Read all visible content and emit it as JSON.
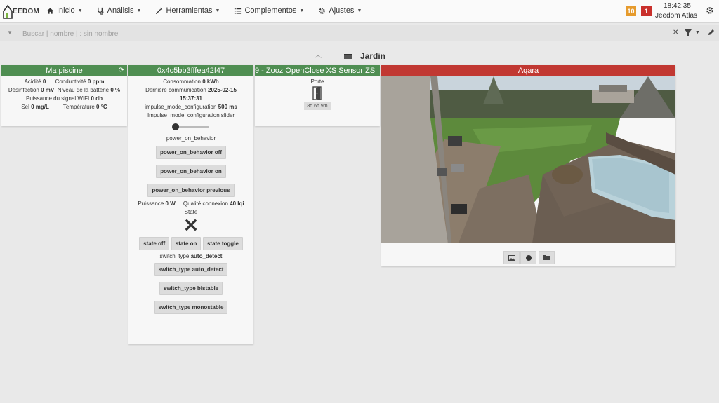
{
  "app": {
    "logo_text": "EEDOM",
    "alerts_warning": "10",
    "alerts_danger": "1",
    "time": "18:42:35",
    "system_name": "Jeedom Atlas"
  },
  "nav": [
    {
      "label": "Inicio",
      "icon": "home-icon"
    },
    {
      "label": "Análisis",
      "icon": "stethoscope-icon"
    },
    {
      "label": "Herramientas",
      "icon": "wrench-icon"
    },
    {
      "label": "Complementos",
      "icon": "list-icon"
    },
    {
      "label": "Ajustes",
      "icon": "gear-icon"
    }
  ],
  "search": {
    "placeholder": "Buscar | nombre | : sin nombre"
  },
  "section": {
    "title": "Jardin"
  },
  "piscine": {
    "title": "Ma piscine",
    "rows": [
      {
        "a_label": "Acidité",
        "a_value": "0",
        "b_label": "Conductivité",
        "b_value": "0 ppm"
      },
      {
        "a_label": "Désinfection",
        "a_value": "0 mV",
        "b_label": "Niveau de la batterie",
        "b_value": "0 %"
      },
      {
        "a_label": "Puissance du signal WIFI",
        "a_value": "0 db",
        "b_label": "",
        "b_value": ""
      },
      {
        "a_label": "Sel",
        "a_value": "0 mg/L",
        "b_label": "Température",
        "b_value": "0 °C"
      }
    ]
  },
  "switch": {
    "title": "0x4c5bb3fffea42f47",
    "consumption_label": "Consommation",
    "consumption_value": "0 kWh",
    "lastcomm_label": "Dernière communication",
    "lastcomm_value_line1": "2025-02-15",
    "lastcomm_value_line2": "15:37:31",
    "impulse_label": "impulse_mode_configuration",
    "impulse_value": "500 ms",
    "slider_label": "Impulse_mode_configuration slider",
    "slider_value": 0,
    "power_on_label": "power_on_behavior",
    "btn_power_off": "power_on_behavior off",
    "btn_power_on": "power_on_behavior on",
    "btn_power_previous": "power_on_behavior previous",
    "puissance_label": "Puissance",
    "puissance_value": "0 W",
    "qualite_label": "Qualité connexion",
    "qualite_value": "40 lqi",
    "state_label": "State",
    "btn_state_off": "state off",
    "btn_state_on": "state on",
    "btn_state_toggle": "state toggle",
    "switch_type_label": "switch_type",
    "switch_type_value": "auto_detect",
    "btn_switch_auto": "switch_type auto_detect",
    "btn_switch_bistable": "switch_type bistable",
    "btn_switch_monostable": "switch_type monostable"
  },
  "zooz": {
    "title": "9 - Zooz OpenClose XS Sensor ZS",
    "porte_label": "Porte",
    "duration": "8d 6h 9m"
  },
  "aqara": {
    "title": "Aqara",
    "buttons": [
      "image-icon",
      "record-icon",
      "folder-icon"
    ]
  },
  "colors": {
    "green_header": "#4f8e52",
    "red_header": "#c13832",
    "warning": "#e69b2d",
    "danger": "#c9302c"
  }
}
